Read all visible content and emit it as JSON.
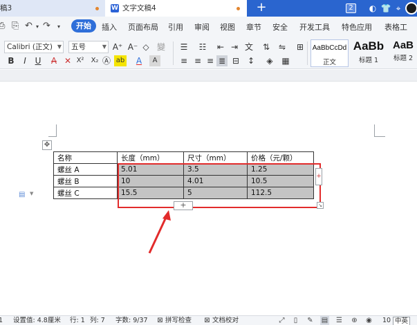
{
  "titlebar": {
    "tabs": [
      {
        "label": "稿3",
        "state": "inactive"
      },
      {
        "label": "文字文稿4",
        "state": "active"
      }
    ],
    "new_tab_symbol": "+",
    "window_count": "2",
    "colors": {
      "bar": "#2a65cf",
      "unsaved_dot": "#e3862f"
    }
  },
  "menu": {
    "items": [
      "开始",
      "插入",
      "页面布局",
      "引用",
      "审阅",
      "视图",
      "章节",
      "安全",
      "开发工具",
      "特色应用",
      "表格工"
    ],
    "active": "开始",
    "quick_icons": [
      "save-icon",
      "undo-icon",
      "redo-icon"
    ],
    "colors": {
      "active_bg": "#2f6fd9"
    }
  },
  "ribbon": {
    "font_name": "Calibri (正文)",
    "font_size": "五号",
    "styles": [
      {
        "sample": "AaBbCcDd",
        "label": "正文"
      },
      {
        "sample": "AaBb",
        "label": "标题 1"
      },
      {
        "sample": "AaB",
        "label": "标题 2"
      }
    ],
    "button_glyphs": {
      "bold": "B",
      "italic": "I",
      "underline": "U",
      "strike": "A",
      "clear": "✕",
      "superscript": "X²",
      "subscript": "X₂",
      "grow": "A⁺",
      "shrink": "A⁻",
      "eraser": "◇",
      "pinyin": "變"
    }
  },
  "table": {
    "header": [
      "名称",
      "长度（mm）",
      "尺寸（mm）",
      "价格（元/颗）"
    ],
    "rows": [
      [
        "螺丝 A",
        "5.01",
        "3.5",
        "1.25"
      ],
      [
        "螺丝 B",
        "10",
        "4.01",
        "10.5"
      ],
      [
        "螺丝 C",
        "15.5",
        "5",
        "112.5"
      ]
    ],
    "selection_highlight": "#c4c4c4",
    "annotation_color": "#e22b2b"
  },
  "statusbar": {
    "page": "1",
    "setting_value": "设置值: 4.8厘米",
    "row": "行: 1",
    "col": "列: 7",
    "word_count": "字数: 9/37",
    "spell_check": "拼写检查",
    "doc_proof": "文档校对",
    "zoom": "10",
    "lang": "中英"
  }
}
